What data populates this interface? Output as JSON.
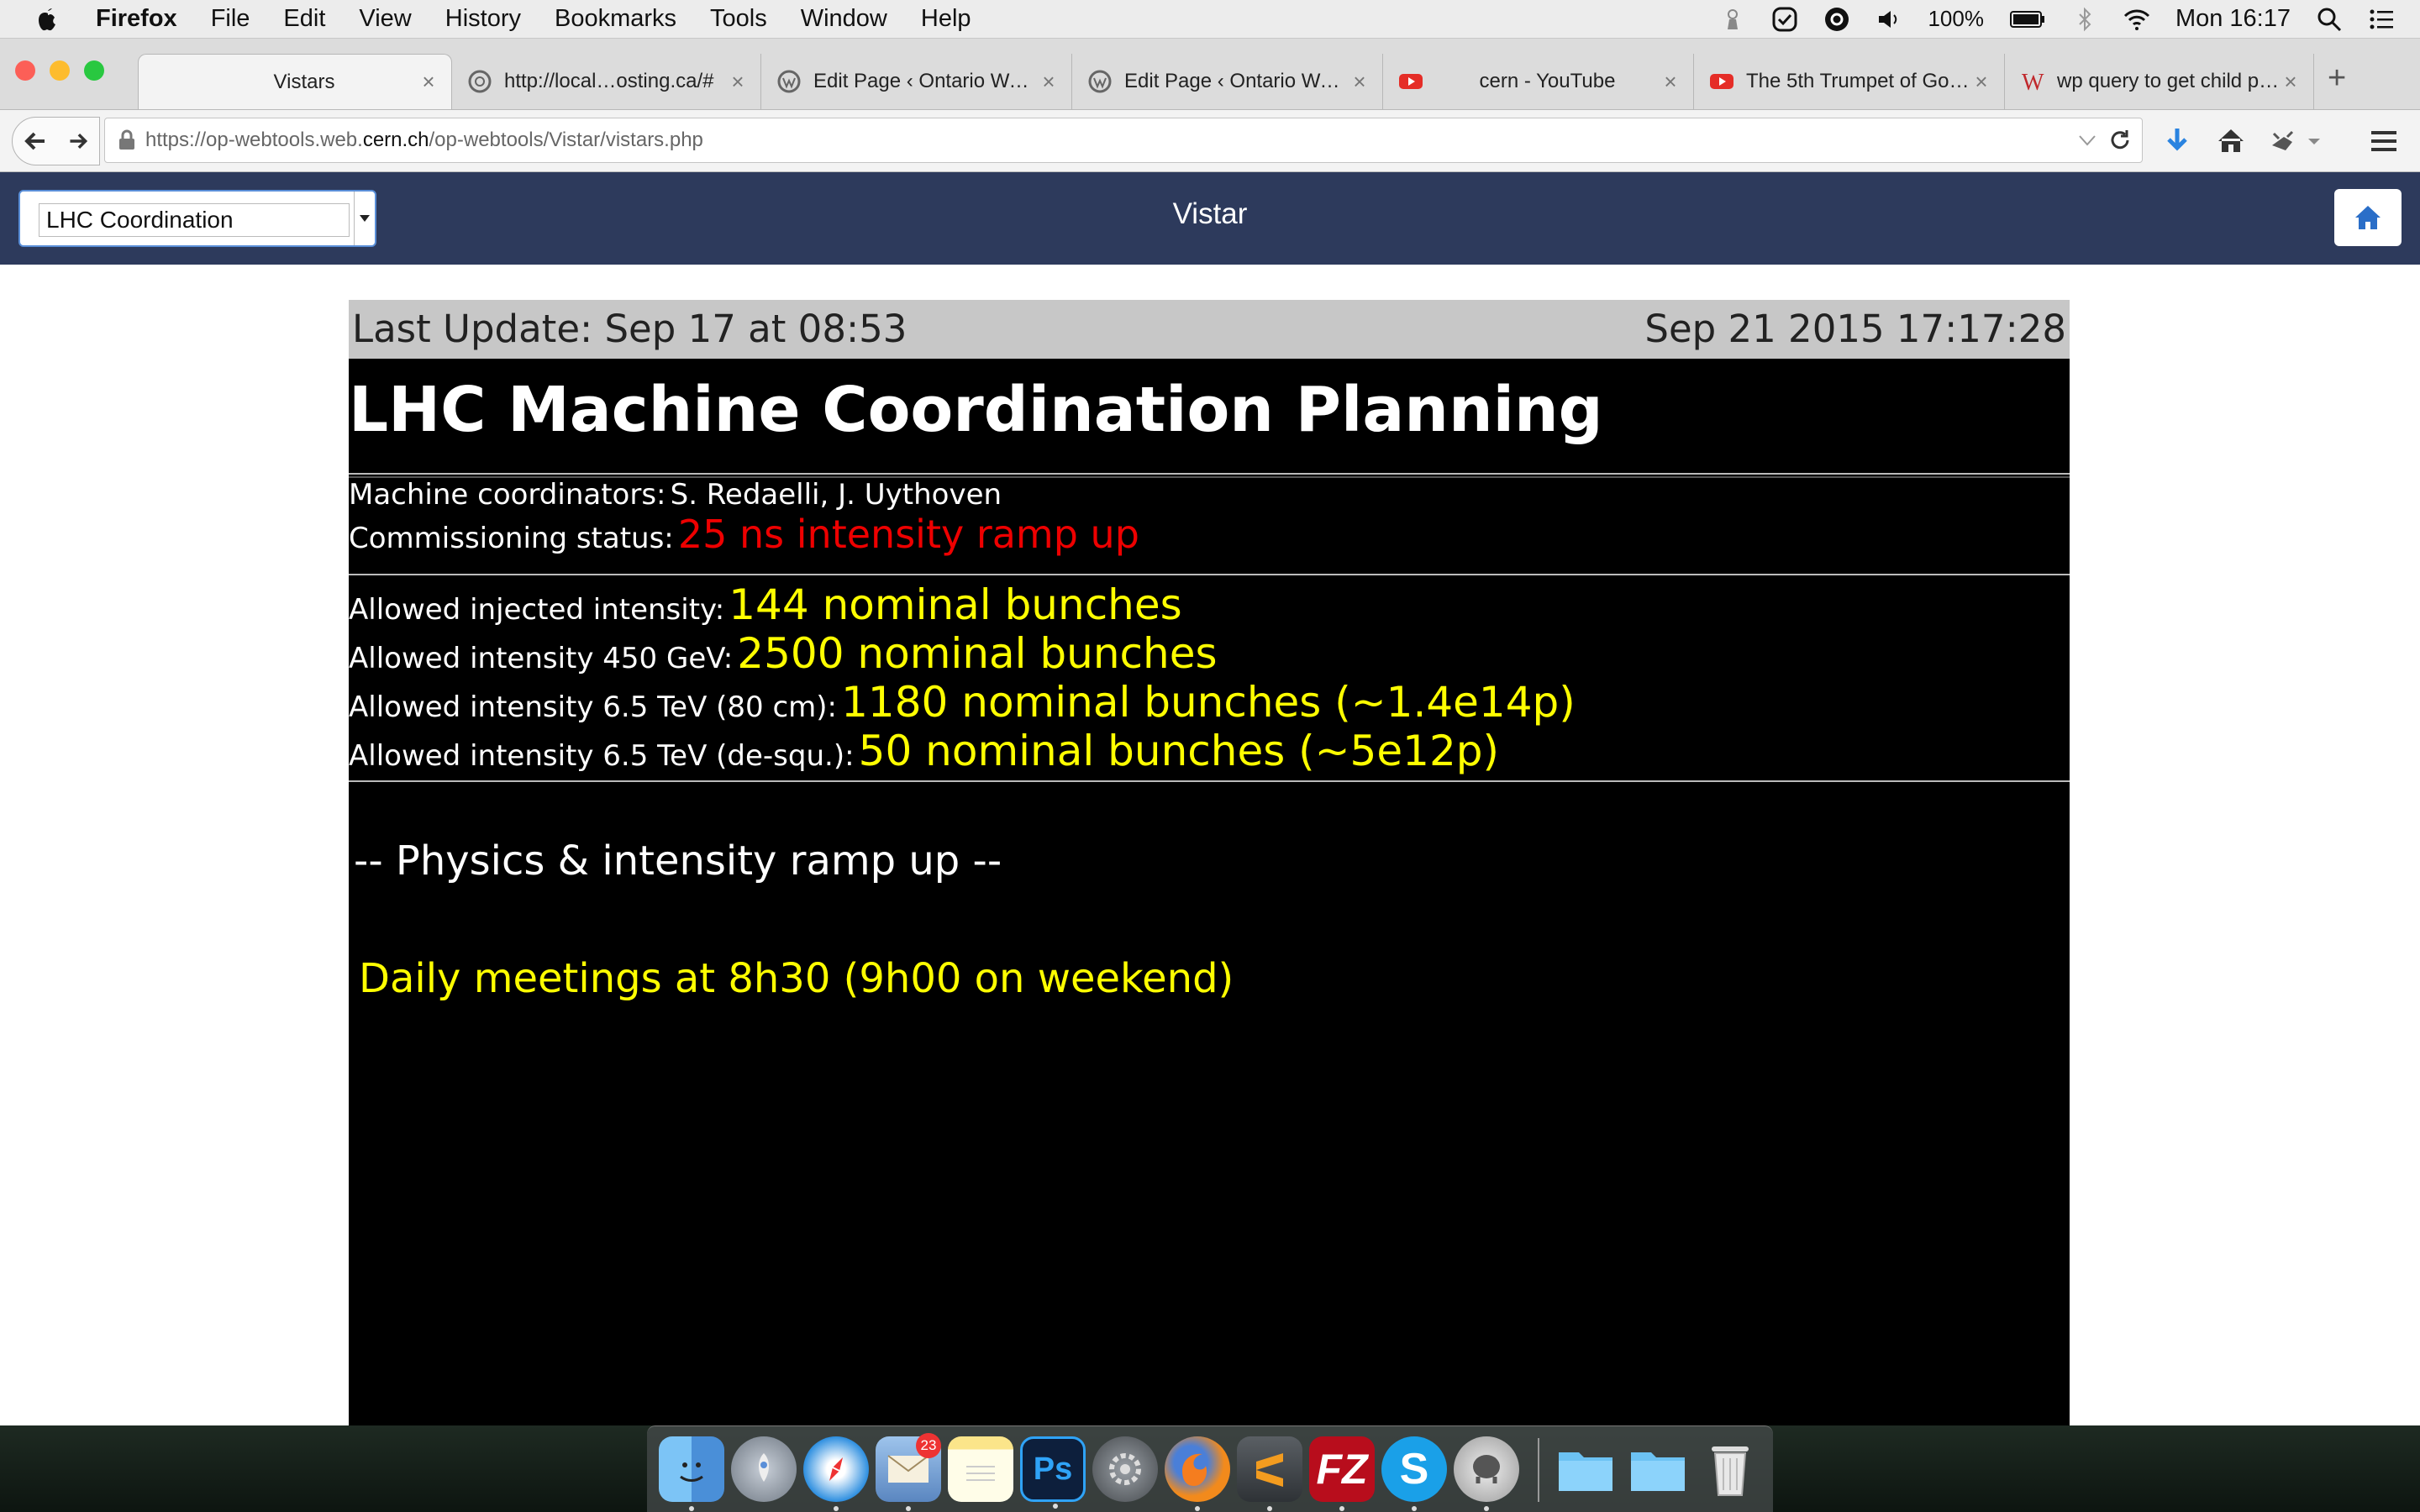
{
  "menubar": {
    "app": "Firefox",
    "items": [
      "File",
      "Edit",
      "View",
      "History",
      "Bookmarks",
      "Tools",
      "Window",
      "Help"
    ],
    "battery": "100%",
    "clock": "Mon 16:17"
  },
  "tabs": [
    {
      "label": "Vistars",
      "icon": "page-icon",
      "active": true
    },
    {
      "label": "http://local…osting.ca/#",
      "icon": "globe-icon"
    },
    {
      "label": "Edit Page ‹ Ontario Wa…",
      "icon": "wordpress-icon"
    },
    {
      "label": "Edit Page ‹ Ontario Wa…",
      "icon": "wordpress-icon"
    },
    {
      "label": "cern - YouTube",
      "icon": "youtube-icon"
    },
    {
      "label": "The 5th Trumpet of Go…",
      "icon": "youtube-icon"
    },
    {
      "label": "wp query to get child p…",
      "icon": "w-icon"
    }
  ],
  "urlbar": {
    "prefix": "https://op-webtools.web.",
    "host": "cern.ch",
    "suffix": "/op-webtools/Vistar/vistars.php"
  },
  "appbar": {
    "select_value": "LHC Coordination",
    "title": "Vistar"
  },
  "vistar": {
    "last_update": "Last Update: Sep 17 at 08:53",
    "datetime": "Sep 21 2015  17:17:28",
    "title": "LHC Machine Coordination Planning",
    "coordinators_label": "Machine coordinators:",
    "coordinators": "S. Redaelli, J. Uythoven",
    "status_label": "Commissioning status:",
    "status_value": "25 ns intensity ramp up",
    "intensities": [
      {
        "label": "Allowed injected intensity:",
        "value": "144 nominal bunches"
      },
      {
        "label": "Allowed intensity 450 GeV:",
        "value": "2500 nominal bunches"
      },
      {
        "label": "Allowed intensity 6.5 TeV (80 cm):",
        "value": "1180 nominal bunches (~1.4e14p)"
      },
      {
        "label": "Allowed intensity 6.5 TeV (de-squ.):",
        "value": "50 nominal bunches (~5e12p)"
      }
    ],
    "section_title": "-- Physics & intensity ramp up --",
    "meeting_note": "Daily meetings at 8h30 (9h00 on weekend)"
  },
  "dock": {
    "items": [
      "finder-icon",
      "launchpad-icon",
      "safari-icon",
      "mail-icon",
      "notes-icon",
      "photoshop-icon",
      "system-preferences-icon",
      "firefox-icon",
      "sublime-text-icon",
      "filezilla-icon",
      "skype-icon",
      "sequel-pro-icon",
      "folder-icon",
      "folder-icon",
      "trash-icon"
    ],
    "mail_badge": "23",
    "photoshop_label": "Ps"
  },
  "colors": {
    "appbar": "#2d3a5c",
    "status_red": "#ee0000",
    "value_yellow": "#ffff00",
    "panel_bg": "#000000"
  }
}
